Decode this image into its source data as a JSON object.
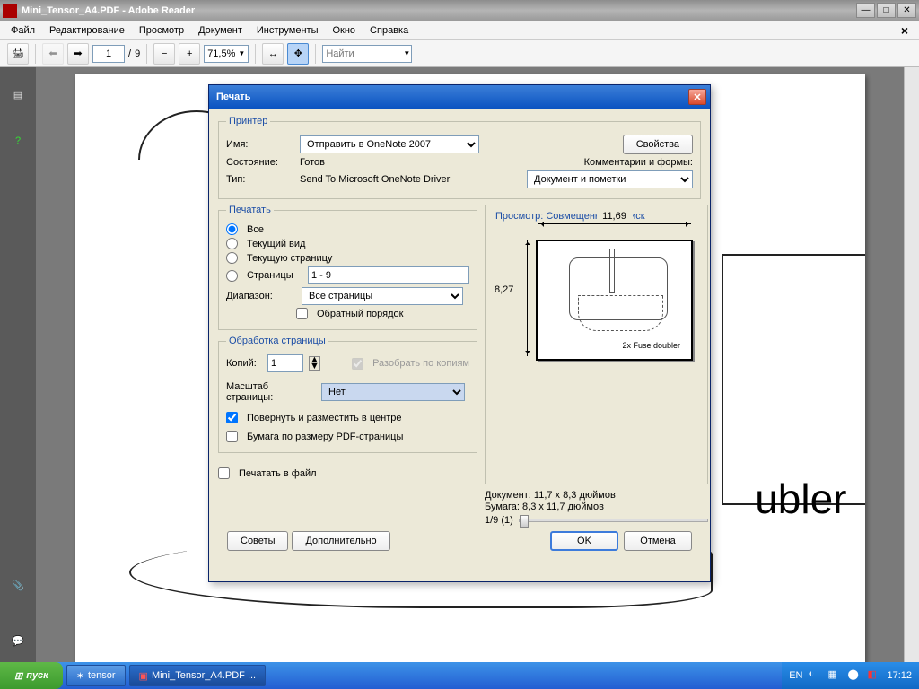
{
  "window": {
    "title": "Mini_Tensor_A4.PDF - Adobe Reader"
  },
  "menubar": {
    "file": "Файл",
    "edit": "Редактирование",
    "view": "Просмотр",
    "doc": "Документ",
    "tools": "Инструменты",
    "window": "Окно",
    "help": "Справка"
  },
  "toolbar": {
    "page_current": "1",
    "page_sep": "/",
    "page_total": "9",
    "zoom": "71,5%",
    "find": "Найти"
  },
  "page": {
    "text": "ubler"
  },
  "dialog": {
    "title": "Печать",
    "printer_group": "Принтер",
    "name_label": "Имя:",
    "printer_name": "Отправить в OneNote 2007",
    "properties": "Свойства",
    "status_label": "Состояние:",
    "status": "Готов",
    "type_label": "Тип:",
    "type": "Send To Microsoft OneNote Driver",
    "comments_label": "Комментарии и формы:",
    "comments_value": "Документ и пометки",
    "range_group": "Печатать",
    "range_all": "Все",
    "range_view": "Текущий вид",
    "range_current": "Текущую страницу",
    "range_pages_label": "Страницы",
    "range_pages": "1 - 9",
    "subset_label": "Диапазон:",
    "subset": "Все страницы",
    "reverse": "Обратный порядок",
    "handling_group": "Обработка страницы",
    "copies_label": "Копий:",
    "copies": "1",
    "collate": "Разобрать по копиям",
    "scale_label": "Масштаб страницы:",
    "scale": "Нет",
    "rotate": "Повернуть и разместить в центре",
    "paper_by_pdf": "Бумага по размеру PDF-страницы",
    "print_to_file": "Печатать в файл",
    "preview_group": "Просмотр: Совмещенный оттиск",
    "dim_h": "11,69",
    "dim_v": "8,27",
    "preview_label": "2x Fuse doubler",
    "doc_size": "Документ: 11,7 x 8,3 дюймов",
    "paper_size": "Бумага: 8,3 x 11,7 дюймов",
    "page_counter": "1/9 (1)",
    "tips": "Советы",
    "advanced": "Дополнительно",
    "ok": "OK",
    "cancel": "Отмена"
  },
  "taskbar": {
    "start": "пуск",
    "item1": "tensor",
    "item2": "Mini_Tensor_A4.PDF ...",
    "lang": "EN",
    "time": "17:12"
  }
}
